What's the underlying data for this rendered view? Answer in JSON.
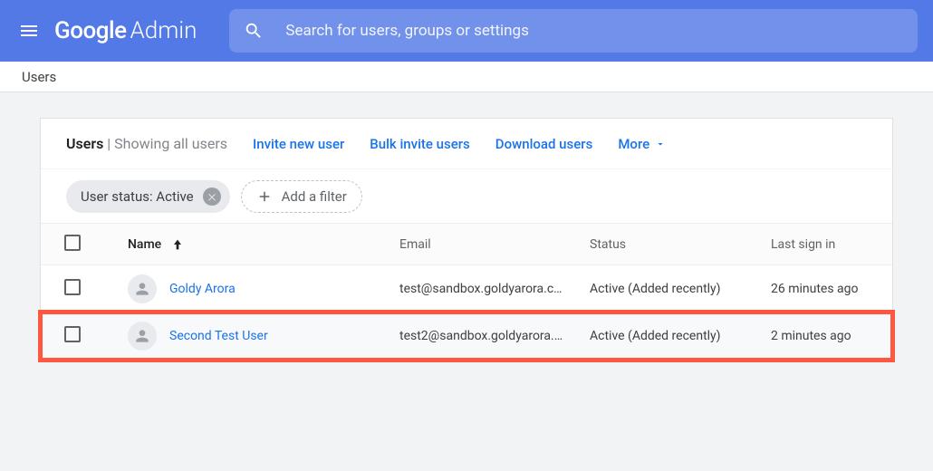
{
  "header": {
    "logo": {
      "google": "Google",
      "admin": "Admin"
    },
    "search_placeholder": "Search for users, groups or settings"
  },
  "breadcrumb": "Users",
  "card": {
    "title": "Users",
    "subtitle": "Showing all users",
    "actions": {
      "invite": "Invite new user",
      "bulk": "Bulk invite users",
      "download": "Download users",
      "more": "More"
    },
    "filters": {
      "chip_label": "User status: Active",
      "add_filter": "Add a filter"
    },
    "columns": {
      "name": "Name",
      "email": "Email",
      "status": "Status",
      "last_sign_in": "Last sign in"
    },
    "rows": [
      {
        "name": "Goldy Arora",
        "email": "test@sandbox.goldyarora.c…",
        "status": "Active (Added recently)",
        "last_sign_in": "26 minutes ago",
        "highlight": false
      },
      {
        "name": "Second Test User",
        "email": "test2@sandbox.goldyarora.…",
        "status": "Active (Added recently)",
        "last_sign_in": "2 minutes ago",
        "highlight": true
      }
    ]
  }
}
